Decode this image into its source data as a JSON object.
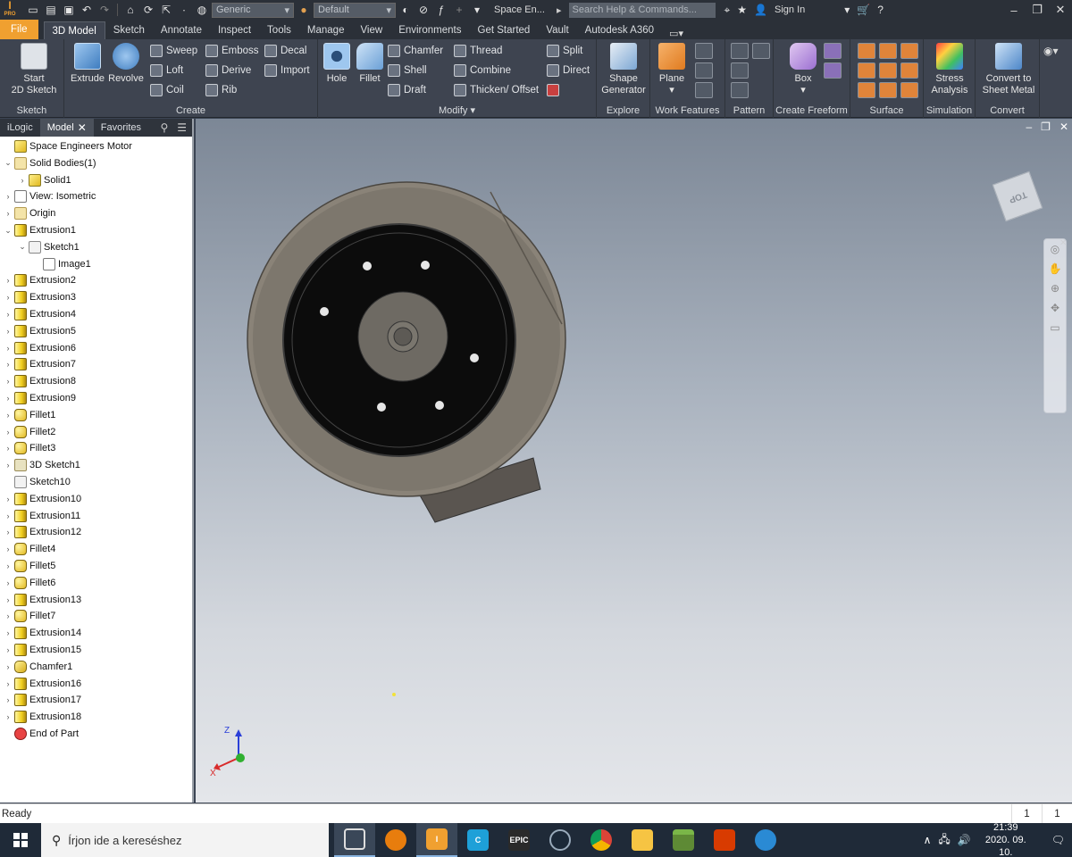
{
  "titlebar": {
    "material_select": "Generic",
    "appearance_select": "Default",
    "doc_title": "Space En...",
    "search_placeholder": "Search Help & Commands...",
    "sign_in": "Sign In"
  },
  "tabs": [
    "File",
    "3D Model",
    "Sketch",
    "Annotate",
    "Inspect",
    "Tools",
    "Manage",
    "View",
    "Environments",
    "Get Started",
    "Vault",
    "Autodesk A360"
  ],
  "ribbon": {
    "sketch": {
      "label": "Sketch",
      "start_sketch": "Start\n2D Sketch"
    },
    "create": {
      "label": "Create",
      "extrude": "Extrude",
      "revolve": "Revolve",
      "sweep": "Sweep",
      "loft": "Loft",
      "coil": "Coil",
      "emboss": "Emboss",
      "derive": "Derive",
      "rib": "Rib",
      "decal": "Decal",
      "import": "Import"
    },
    "modify": {
      "label": "Modify",
      "hole": "Hole",
      "fillet": "Fillet",
      "chamfer": "Chamfer",
      "shell": "Shell",
      "draft": "Draft",
      "thread": "Thread",
      "combine": "Combine",
      "thicken": "Thicken/ Offset",
      "split": "Split",
      "direct": "Direct"
    },
    "explore": {
      "label": "Explore",
      "shape_generator": "Shape\nGenerator"
    },
    "work_features": {
      "label": "Work Features",
      "plane": "Plane"
    },
    "pattern": {
      "label": "Pattern"
    },
    "freeform": {
      "label": "Create Freeform",
      "box": "Box"
    },
    "surface": {
      "label": "Surface"
    },
    "simulation": {
      "label": "Simulation",
      "stress": "Stress\nAnalysis"
    },
    "convert": {
      "label": "Convert",
      "sheet_metal": "Convert to\nSheet Metal"
    }
  },
  "browser": {
    "tabs": [
      "iLogic",
      "Model",
      "Favorites"
    ],
    "nodes": [
      {
        "label": "Space Engineers Motor",
        "icon": "part-icon",
        "indent": 0,
        "arrow": ""
      },
      {
        "label": "Solid Bodies(1)",
        "icon": "folder-icon",
        "indent": 0,
        "arrow": "open"
      },
      {
        "label": "Solid1",
        "icon": "part-icon",
        "indent": 1,
        "arrow": "closed"
      },
      {
        "label": "View: Isometric",
        "icon": "view-icon",
        "indent": 0,
        "arrow": "closed"
      },
      {
        "label": "Origin",
        "icon": "folder-icon",
        "indent": 0,
        "arrow": "closed"
      },
      {
        "label": "Extrusion1",
        "icon": "extrusion-icon",
        "indent": 0,
        "arrow": "open"
      },
      {
        "label": "Sketch1",
        "icon": "sketch-icon",
        "indent": 1,
        "arrow": "open"
      },
      {
        "label": "Image1",
        "icon": "image-icon",
        "indent": 2,
        "arrow": ""
      },
      {
        "label": "Extrusion2",
        "icon": "extrusion-icon",
        "indent": 0,
        "arrow": "closed"
      },
      {
        "label": "Extrusion3",
        "icon": "extrusion-icon",
        "indent": 0,
        "arrow": "closed"
      },
      {
        "label": "Extrusion4",
        "icon": "extrusion-icon",
        "indent": 0,
        "arrow": "closed"
      },
      {
        "label": "Extrusion5",
        "icon": "extrusion-icon",
        "indent": 0,
        "arrow": "closed"
      },
      {
        "label": "Extrusion6",
        "icon": "extrusion-icon",
        "indent": 0,
        "arrow": "closed"
      },
      {
        "label": "Extrusion7",
        "icon": "extrusion-icon",
        "indent": 0,
        "arrow": "closed"
      },
      {
        "label": "Extrusion8",
        "icon": "extrusion-icon",
        "indent": 0,
        "arrow": "closed"
      },
      {
        "label": "Extrusion9",
        "icon": "extrusion-icon",
        "indent": 0,
        "arrow": "closed"
      },
      {
        "label": "Fillet1",
        "icon": "fillet-icon",
        "indent": 0,
        "arrow": "closed"
      },
      {
        "label": "Fillet2",
        "icon": "fillet-icon",
        "indent": 0,
        "arrow": "closed"
      },
      {
        "label": "Fillet3",
        "icon": "fillet-icon",
        "indent": 0,
        "arrow": "closed"
      },
      {
        "label": "3D Sketch1",
        "icon": "sketch3d-icon",
        "indent": 0,
        "arrow": "closed"
      },
      {
        "label": "Sketch10",
        "icon": "sketch-icon",
        "indent": 0,
        "arrow": ""
      },
      {
        "label": "Extrusion10",
        "icon": "extrusion-icon",
        "indent": 0,
        "arrow": "closed"
      },
      {
        "label": "Extrusion11",
        "icon": "extrusion-icon",
        "indent": 0,
        "arrow": "closed"
      },
      {
        "label": "Extrusion12",
        "icon": "extrusion-icon",
        "indent": 0,
        "arrow": "closed"
      },
      {
        "label": "Fillet4",
        "icon": "fillet-icon",
        "indent": 0,
        "arrow": "closed"
      },
      {
        "label": "Fillet5",
        "icon": "fillet-icon",
        "indent": 0,
        "arrow": "closed"
      },
      {
        "label": "Fillet6",
        "icon": "fillet-icon",
        "indent": 0,
        "arrow": "closed"
      },
      {
        "label": "Extrusion13",
        "icon": "extrusion-icon",
        "indent": 0,
        "arrow": "closed"
      },
      {
        "label": "Fillet7",
        "icon": "fillet-icon",
        "indent": 0,
        "arrow": "closed"
      },
      {
        "label": "Extrusion14",
        "icon": "extrusion-icon",
        "indent": 0,
        "arrow": "closed"
      },
      {
        "label": "Extrusion15",
        "icon": "extrusion-icon",
        "indent": 0,
        "arrow": "closed"
      },
      {
        "label": "Chamfer1",
        "icon": "chamfer-icon",
        "indent": 0,
        "arrow": "closed"
      },
      {
        "label": "Extrusion16",
        "icon": "extrusion-icon",
        "indent": 0,
        "arrow": "closed"
      },
      {
        "label": "Extrusion17",
        "icon": "extrusion-icon",
        "indent": 0,
        "arrow": "closed"
      },
      {
        "label": "Extrusion18",
        "icon": "extrusion-icon",
        "indent": 0,
        "arrow": "closed"
      },
      {
        "label": "End of Part",
        "icon": "end-of-part-icon",
        "indent": 0,
        "arrow": ""
      }
    ]
  },
  "viewport": {
    "viewcube_face": "TOP",
    "axis_z": "Z",
    "axis_x": "X"
  },
  "status": {
    "text": "Ready",
    "count1": "1",
    "count2": "1"
  },
  "taskbar": {
    "search_placeholder": "Írjon ide a kereséshez",
    "time": "21:39",
    "date": "2020. 09. 10.",
    "epic_label": "EPIC"
  },
  "colors": {
    "accent": "#f0a030",
    "ribbon_bg": "#3e4450",
    "titlebar_bg": "#2b3038"
  }
}
